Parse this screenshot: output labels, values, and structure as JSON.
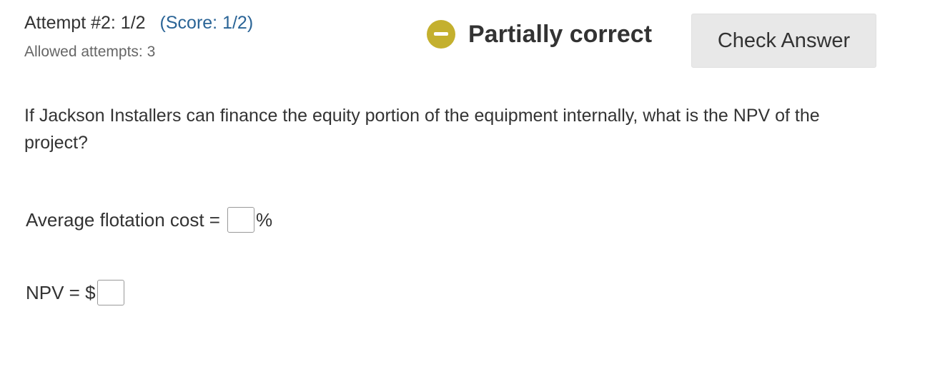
{
  "attempt": {
    "label": "Attempt #2: 1/2",
    "score": "(Score: 1/2)",
    "allowed": "Allowed attempts: 3"
  },
  "status": {
    "text": "Partially correct",
    "icon": "minus-circle-icon",
    "icon_color": "#c4b02e"
  },
  "check_button": {
    "label": "Check Answer"
  },
  "question": {
    "text": "If Jackson Installers can finance the equity portion of the equipment internally, what is the NPV of the project?"
  },
  "fields": {
    "flotation": {
      "label": "Average flotation cost =",
      "value": "",
      "unit": "%"
    },
    "npv": {
      "label": "NPV = $",
      "value": ""
    }
  }
}
